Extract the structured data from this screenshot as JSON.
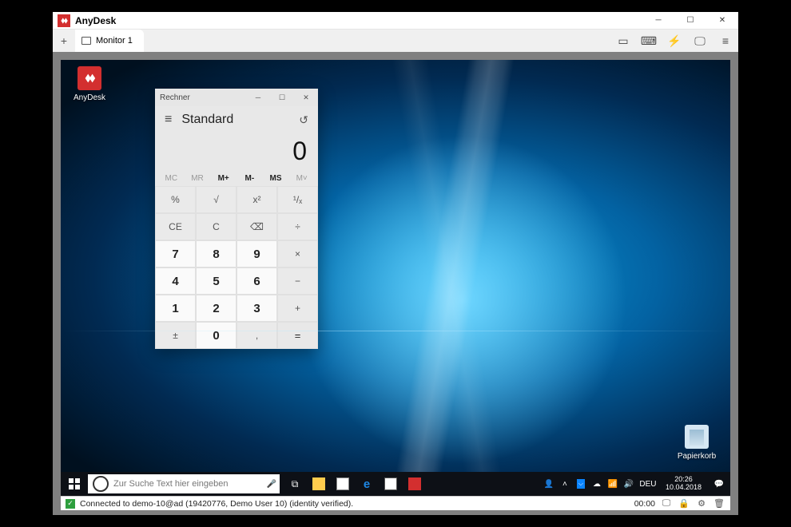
{
  "app": {
    "title": "AnyDesk"
  },
  "tabs": {
    "monitor_label": "Monitor 1"
  },
  "remote": {
    "desktop_icons": {
      "anydesk": "AnyDesk",
      "trash": "Papierkorb"
    },
    "calculator": {
      "title": "Rechner",
      "mode": "Standard",
      "display": "0",
      "memory": {
        "mc": "MC",
        "mr": "MR",
        "mp": "M+",
        "mm": "M-",
        "ms": "MS",
        "mt": "M˅"
      },
      "keys": {
        "percent": "%",
        "sqrt": "√",
        "square": "x²",
        "recip": "¹/ₓ",
        "ce": "CE",
        "c": "C",
        "back": "⌫",
        "div": "÷",
        "k7": "7",
        "k8": "8",
        "k9": "9",
        "mul": "×",
        "k4": "4",
        "k5": "5",
        "k6": "6",
        "sub": "−",
        "k1": "1",
        "k2": "2",
        "k3": "3",
        "add": "+",
        "neg": "±",
        "k0": "0",
        "dec": ",",
        "eq": "="
      }
    },
    "taskbar": {
      "search_placeholder": "Zur Suche Text hier eingeben",
      "lang": "DEU",
      "time": "20:26",
      "date": "10.04.2018"
    }
  },
  "status": {
    "text": "Connected to demo-10@ad (19420776, Demo User 10) (identity verified).",
    "elapsed": "00:00"
  }
}
